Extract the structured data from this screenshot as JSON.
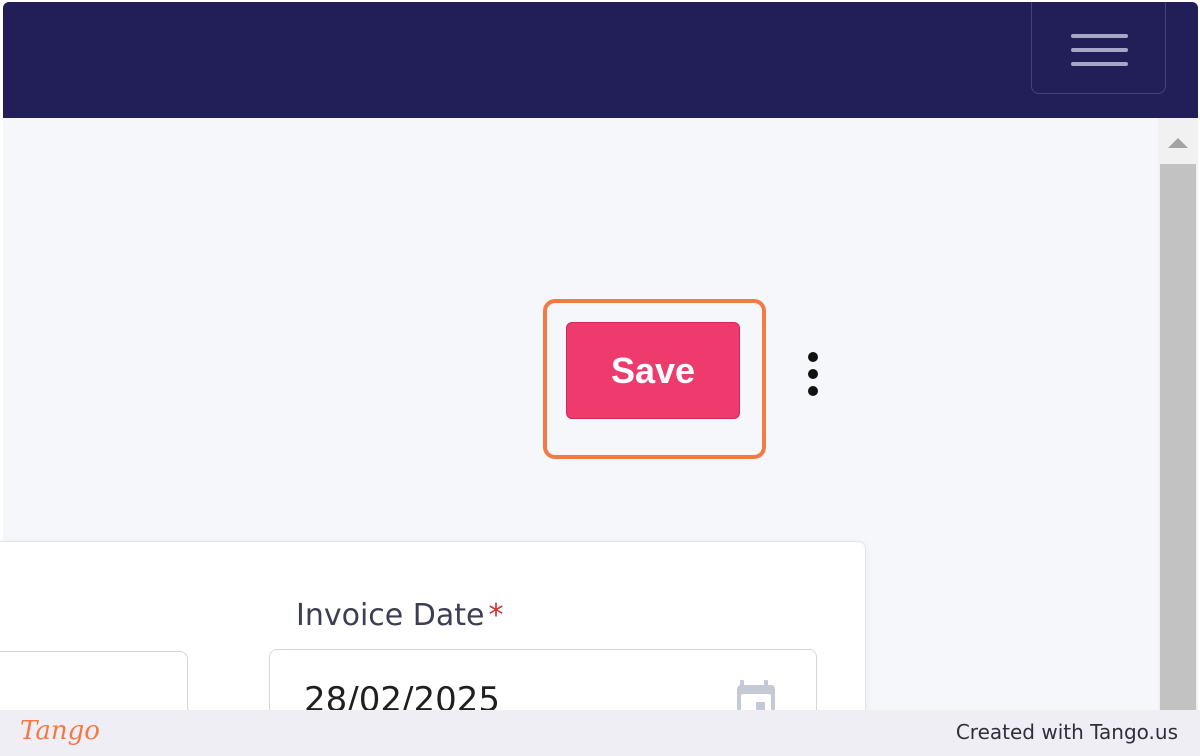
{
  "header": {
    "menu_icon": "hamburger-menu-icon"
  },
  "toolbar": {
    "save_label": "Save",
    "more_icon": "more-vertical-icon"
  },
  "form": {
    "invoice_date": {
      "label": "Invoice Date",
      "required_mark": "*",
      "value": "28/02/2025",
      "icon": "calendar-icon"
    }
  },
  "footer": {
    "logo_text": "Tango",
    "credit": "Created with Tango.us"
  },
  "colors": {
    "header_bg": "#221e58",
    "save_button": "#ee3a6c",
    "highlight": "#f47a45"
  }
}
